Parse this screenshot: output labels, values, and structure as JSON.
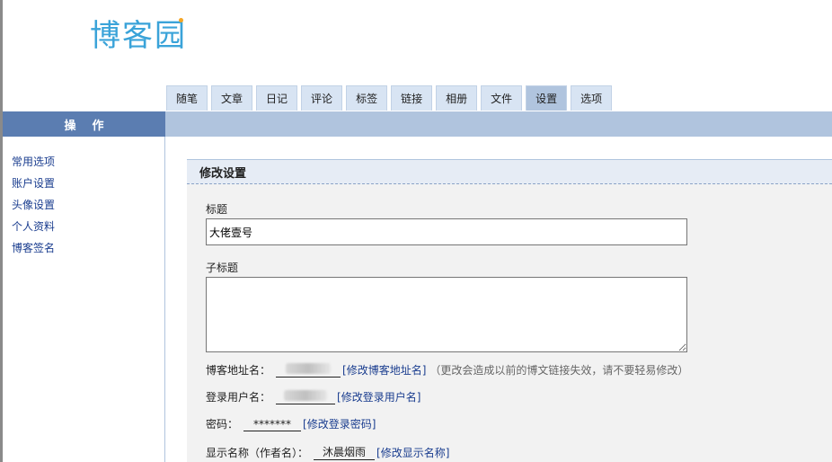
{
  "logo": {
    "text": "博客园"
  },
  "tabs": [
    {
      "label": "随笔"
    },
    {
      "label": "文章"
    },
    {
      "label": "日记"
    },
    {
      "label": "评论"
    },
    {
      "label": "标签"
    },
    {
      "label": "链接"
    },
    {
      "label": "相册"
    },
    {
      "label": "文件"
    },
    {
      "label": "设置",
      "active": true
    },
    {
      "label": "选项"
    }
  ],
  "sidebar": {
    "header": "操作",
    "items": [
      {
        "label": "常用选项"
      },
      {
        "label": "账户设置"
      },
      {
        "label": "头像设置"
      },
      {
        "label": "个人资料"
      },
      {
        "label": "博客签名"
      }
    ]
  },
  "form": {
    "section_title": "修改设置",
    "title_label": "标题",
    "title_value": "大佬壹号",
    "subtitle_label": "子标题",
    "subtitle_value": "",
    "blog_address_label": "博客地址名：",
    "blog_address_link": "[修改博客地址名]",
    "blog_address_note": "（更改会造成以前的博文链接失效，请不要轻易修改）",
    "login_name_label": "登录用户名：",
    "login_name_link": "[修改登录用户名]",
    "password_label": "密码：",
    "password_value": "*******",
    "password_link": "[修改登录密码]",
    "display_name_label": "显示名称（作者名）：",
    "display_name_value": "沐晨烟雨",
    "display_name_link": "[修改显示名称]"
  },
  "colors": {
    "accent": "#5b7db1",
    "tab_bg": "#d8e4f3",
    "bar": "#b0c4de",
    "link": "#1a3d8f",
    "logo": "#3aa3d9"
  }
}
